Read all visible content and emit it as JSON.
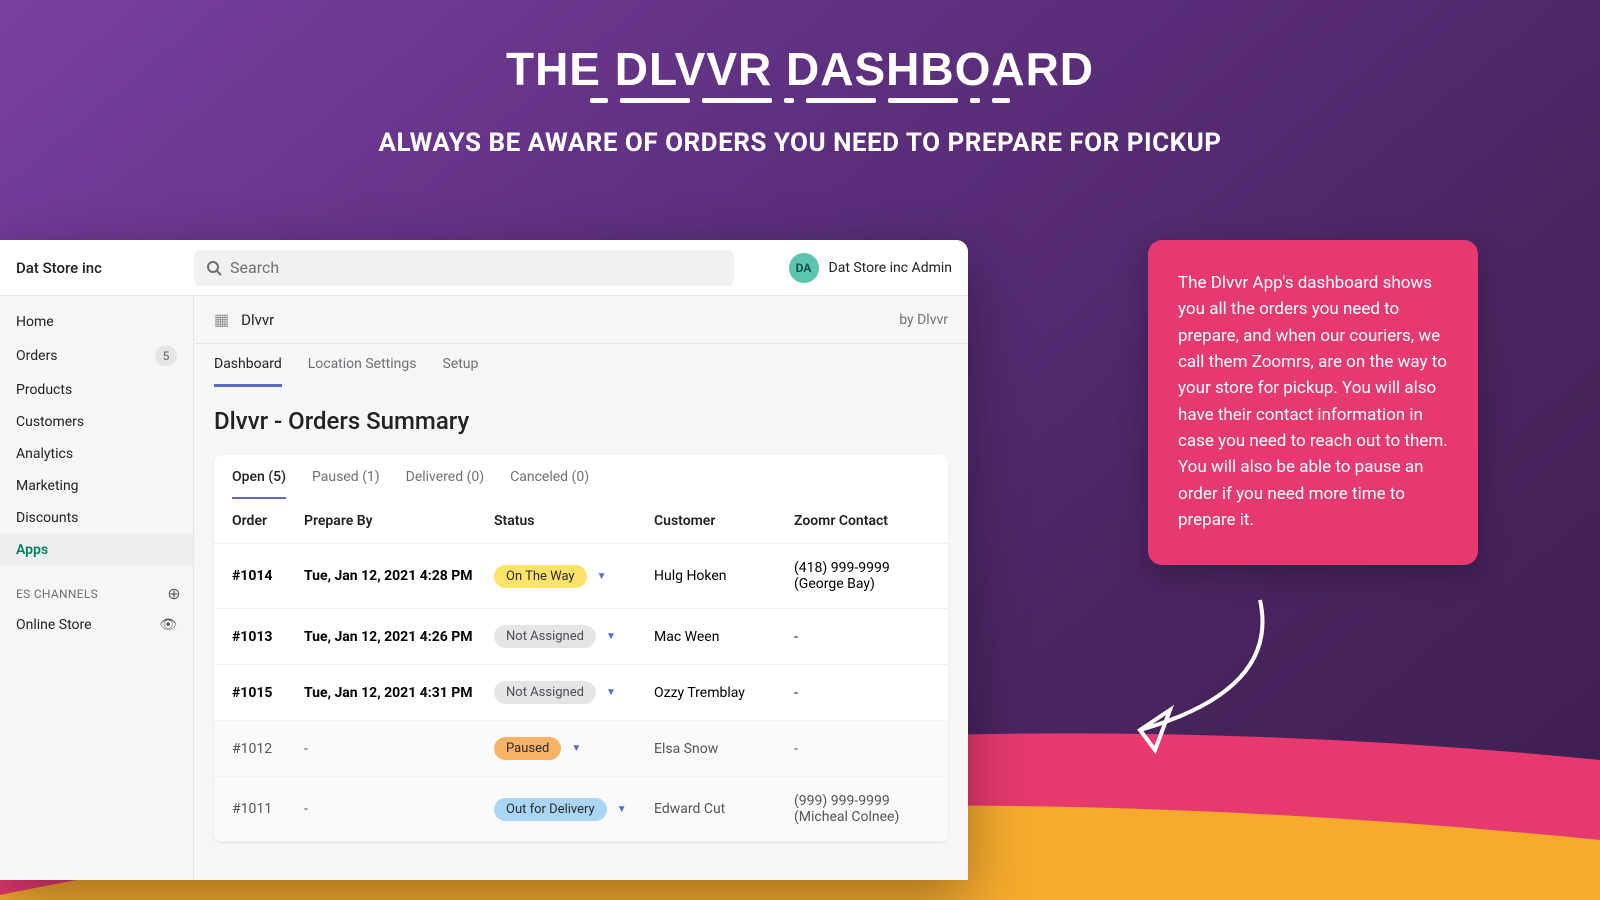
{
  "hero": {
    "title": "THE DLVVR DASHBOARD",
    "subtitle": "ALWAYS BE AWARE OF ORDERS YOU NEED TO PREPARE FOR PICKUP"
  },
  "callout": {
    "text": "The Dlvvr App's dashboard shows you all the orders you need to prepare, and when our couriers, we call them Zoomrs, are on the way to your store for pickup. You will also have their contact information in case you need to reach out to them. You will also be able to pause an order if you need more time to prepare it."
  },
  "topbar": {
    "store": "Dat Store inc",
    "search_placeholder": "Search",
    "avatar_initials": "DA",
    "user": "Dat Store inc Admin"
  },
  "sidebar": {
    "items": [
      {
        "label": "Home"
      },
      {
        "label": "Orders",
        "badge": "5"
      },
      {
        "label": "Products"
      },
      {
        "label": "Customers"
      },
      {
        "label": "Analytics"
      },
      {
        "label": "Marketing"
      },
      {
        "label": "Discounts"
      },
      {
        "label": "Apps",
        "active": true
      }
    ],
    "section_label": "ES CHANNELS",
    "online_store": "Online Store"
  },
  "app": {
    "name": "Dlvvr",
    "by": "by Dlvvr",
    "tabs": [
      {
        "label": "Dashboard",
        "active": true
      },
      {
        "label": "Location Settings"
      },
      {
        "label": "Setup"
      }
    ],
    "page_title": "Dlvvr - Orders Summary",
    "status_tabs": [
      {
        "label": "Open (5)",
        "active": true
      },
      {
        "label": "Paused (1)"
      },
      {
        "label": "Delivered (0)"
      },
      {
        "label": "Canceled (0)"
      }
    ],
    "columns": {
      "order": "Order",
      "prepare": "Prepare By",
      "status": "Status",
      "customer": "Customer",
      "zoomr": "Zoomr Contact"
    },
    "rows": [
      {
        "order": "#1014",
        "prepare": "Tue, Jan 12, 2021 4:28 PM",
        "status": "On The Way",
        "pill": "yellow",
        "customer": "Hulg Hoken",
        "zoomr": "(418) 999-9999 (George Bay)",
        "bold": true
      },
      {
        "order": "#1013",
        "prepare": "Tue, Jan 12, 2021 4:26 PM",
        "status": "Not Assigned",
        "pill": "gray",
        "customer": "Mac Ween",
        "zoomr": "-",
        "bold": true
      },
      {
        "order": "#1015",
        "prepare": "Tue, Jan 12, 2021 4:31 PM",
        "status": "Not Assigned",
        "pill": "gray",
        "customer": "Ozzy Tremblay",
        "zoomr": "-",
        "bold": true
      },
      {
        "order": "#1012",
        "prepare": "-",
        "status": "Paused",
        "pill": "orange",
        "customer": "Elsa Snow",
        "zoomr": "-",
        "dim": true
      },
      {
        "order": "#1011",
        "prepare": "-",
        "status": "Out for Delivery",
        "pill": "blue",
        "customer": "Edward Cut",
        "zoomr": "(999) 999-9999 (Micheal Colnee)",
        "dim": true
      }
    ]
  }
}
